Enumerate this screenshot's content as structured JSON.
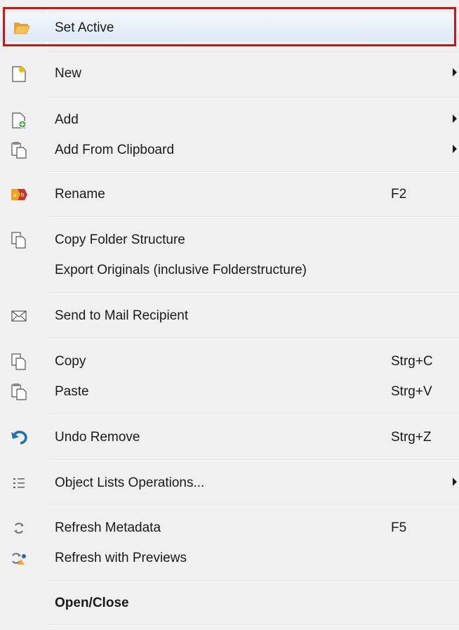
{
  "menu": {
    "items": [
      {
        "label": "Set Active",
        "icon": "folder-open-icon"
      },
      {
        "label": "New",
        "icon": "new-document-icon"
      },
      {
        "label": "Add",
        "icon": "add-document-icon"
      },
      {
        "label": "Add From Clipboard",
        "icon": "clipboard-add-icon"
      },
      {
        "label": "Rename",
        "icon": "rename-ab-icon",
        "shortcut": "F2"
      },
      {
        "label": "Copy Folder Structure",
        "icon": "copy-structure-icon"
      },
      {
        "label": "Export Originals (inclusive Folderstructure)"
      },
      {
        "label": "Send to Mail Recipient",
        "icon": "mail-icon"
      },
      {
        "label": "Copy",
        "icon": "copy-icon",
        "shortcut": "Strg+C"
      },
      {
        "label": "Paste",
        "icon": "paste-icon",
        "shortcut": "Strg+V"
      },
      {
        "label": "Undo Remove",
        "icon": "undo-icon",
        "shortcut": "Strg+Z"
      },
      {
        "label": "Object Lists Operations...",
        "icon": "list-icon"
      },
      {
        "label": "Refresh Metadata",
        "icon": "refresh-icon",
        "shortcut": "F5"
      },
      {
        "label": "Refresh with Previews",
        "icon": "refresh-previews-icon"
      },
      {
        "label": "Open/Close"
      }
    ]
  },
  "colors": {
    "highlight_border": "#c21a1a",
    "accent_blue": "#1f6fb5",
    "folder_orange": "#f0a830"
  }
}
